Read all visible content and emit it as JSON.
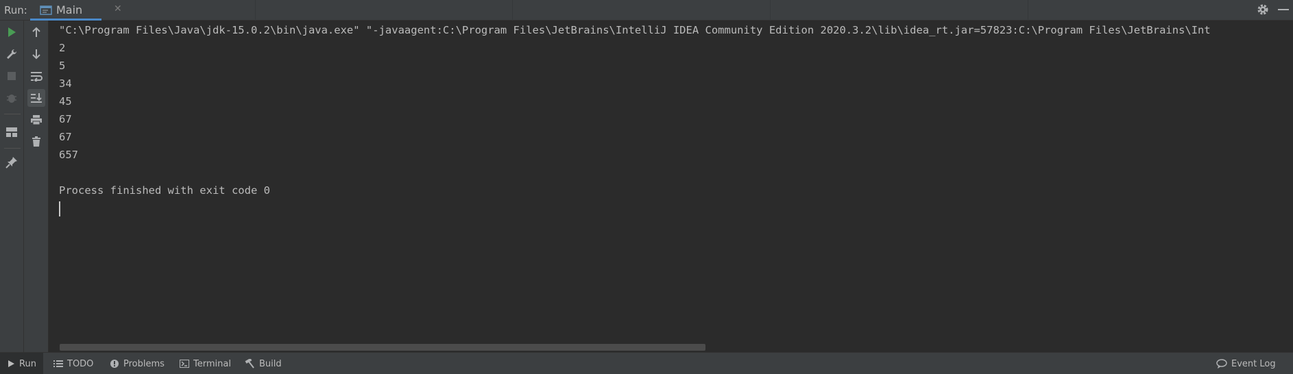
{
  "run_panel": {
    "label": "Run:",
    "tab": {
      "label": "Main",
      "close_glyph": "✕",
      "icon": "run-config-icon"
    }
  },
  "top_right": {
    "settings_icon": "gear-icon",
    "minimize_icon": "minimize-icon"
  },
  "toolbar_outer": [
    "rerun-icon",
    "edit-config-icon",
    "stop-icon",
    "debug-icon",
    "layout-icon",
    "pin-icon"
  ],
  "toolbar_inner": [
    "up-arrow-icon",
    "down-arrow-icon",
    "soft-wrap-icon",
    "scroll-to-end-icon",
    "print-icon",
    "trash-icon"
  ],
  "console": {
    "lines": [
      "\"C:\\Program Files\\Java\\jdk-15.0.2\\bin\\java.exe\" \"-javaagent:C:\\Program Files\\JetBrains\\IntelliJ IDEA Community Edition 2020.3.2\\lib\\idea_rt.jar=57823:C:\\Program Files\\JetBrains\\Int",
      "2",
      "5",
      "34",
      "45",
      "67",
      "67",
      "657",
      "",
      "Process finished with exit code 0"
    ]
  },
  "bottom_bar": {
    "run": "Run",
    "todo": "TODO",
    "problems": "Problems",
    "terminal": "Terminal",
    "build": "Build",
    "event_log": "Event Log"
  },
  "colors": {
    "accent": "#4a88c7",
    "run_green": "#499c54",
    "background": "#2b2b2b",
    "panel": "#3c3f41"
  }
}
